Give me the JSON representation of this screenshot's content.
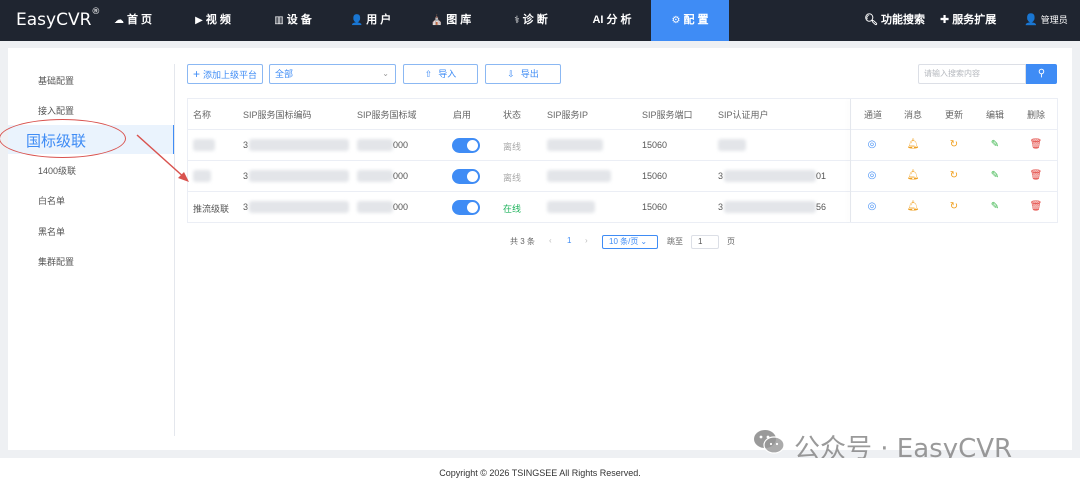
{
  "app": {
    "brand": "EasyCVR",
    "brand_mark": "®"
  },
  "nav": {
    "items": [
      {
        "icon": "☁",
        "label": "首 页"
      },
      {
        "icon": "▶",
        "label": "视 频"
      },
      {
        "icon": "▥",
        "label": "设 备"
      },
      {
        "icon": "👤",
        "label": "用 户"
      },
      {
        "icon": "⛪",
        "label": "图 库"
      },
      {
        "icon": "⚕",
        "label": "诊 断"
      },
      {
        "icon": "",
        "label": "AI 分 析"
      },
      {
        "icon": "⚙",
        "label": "配 置"
      }
    ],
    "active": "配 置",
    "search_feature": "功能搜索",
    "extension": "服务扩展",
    "user": "管理员"
  },
  "sidebar": {
    "items": [
      "基础配置",
      "接入配置",
      "国标级联",
      "1400级联",
      "白名单",
      "黑名单",
      "集群配置"
    ],
    "active": "国标级联"
  },
  "toolbar": {
    "add_label": "添加上级平台",
    "filter_value": "全部",
    "import_label": "导入",
    "export_label": "导出",
    "search_placeholder": "请输入搜索内容"
  },
  "table": {
    "headers": [
      "名称",
      "SIP服务国标编码",
      "SIP服务国标域",
      "启用",
      "状态",
      "SIP服务IP",
      "SIP服务端口",
      "SIP认证用户",
      "通道",
      "消息",
      "更新",
      "编辑",
      "删除"
    ],
    "rows": [
      {
        "name": "",
        "code_prefix": "3",
        "domain_suffix": "000",
        "enabled": true,
        "status": "离线",
        "ip": "",
        "port": "15060",
        "auth_user_prefix": "",
        "auth_user_suffix": ""
      },
      {
        "name": "",
        "code_prefix": "3",
        "domain_suffix": "000",
        "enabled": true,
        "status": "离线",
        "ip": "",
        "port": "15060",
        "auth_user_prefix": "3",
        "auth_user_suffix": "01"
      },
      {
        "name": "推流级联",
        "code_prefix": "3",
        "domain_suffix": "000",
        "enabled": true,
        "status": "在线",
        "ip": "",
        "port": "15060",
        "auth_user_prefix": "3",
        "auth_user_suffix": "56"
      }
    ]
  },
  "pagination": {
    "total": "共 3 条",
    "prev": "‹",
    "current": "1",
    "next": "›",
    "page_size": "10 条/页",
    "goto_label": "跳至",
    "goto_value": "1",
    "page_unit": "页"
  },
  "footer": {
    "copyright": "Copyright © 2026 TSINGSEE All Rights Reserved."
  },
  "watermark": "公众号 · EasyCVR",
  "colors": {
    "primary": "#3f8cf5",
    "nav_bg": "#1f2530",
    "online": "#1fb35c",
    "annotation": "#d9534f"
  }
}
